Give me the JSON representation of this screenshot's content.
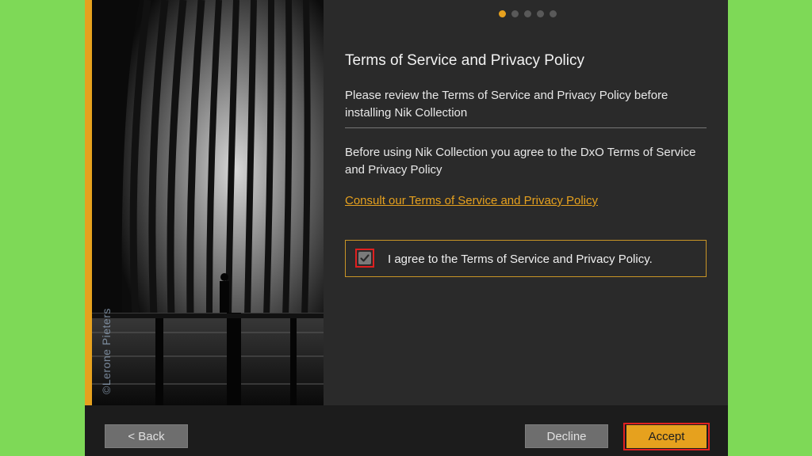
{
  "installer": {
    "photo_credit": "©Lerone Pieters",
    "steps": {
      "total": 5,
      "active_index": 0
    },
    "title": "Terms of Service and Privacy Policy",
    "intro": "Please review the Terms of Service and Privacy Policy before installing Nik Collection",
    "agreement_text": "Before using Nik Collection you agree to the DxO Terms of Service and Privacy Policy",
    "consult_link": "Consult our Terms of Service and Privacy Policy",
    "agree_checkbox": {
      "label": "I agree to the Terms of Service and Privacy Policy.",
      "checked": true
    },
    "buttons": {
      "back": "< Back",
      "decline": "Decline",
      "accept": "Accept"
    }
  },
  "colors": {
    "accent": "#e6a11e",
    "background": "#7ed957",
    "panel": "#2a2a2a",
    "footer": "#1c1c1c",
    "highlight": "#e02020"
  }
}
